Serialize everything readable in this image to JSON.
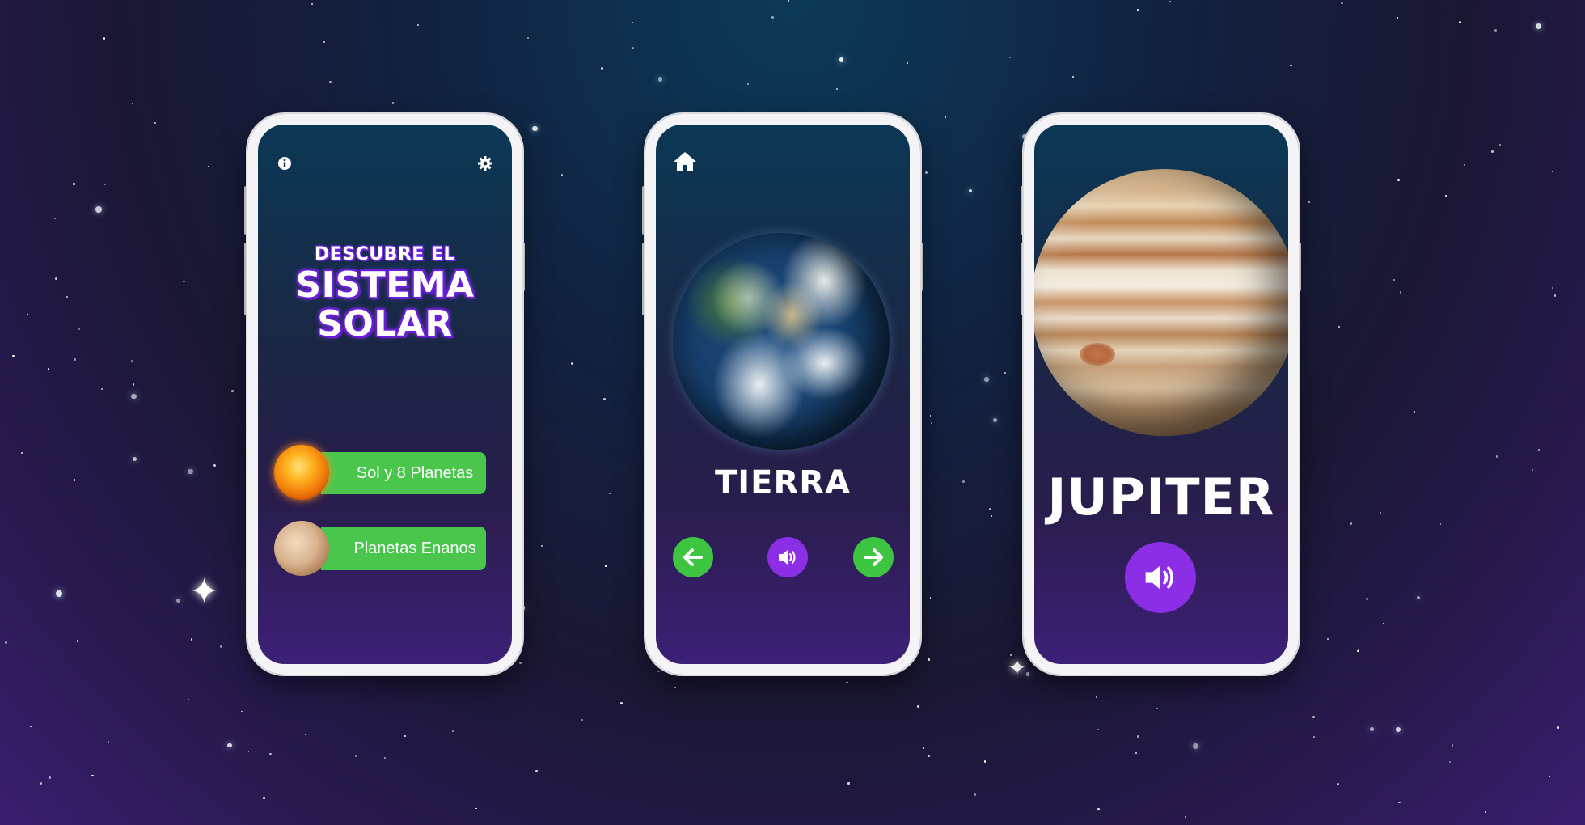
{
  "background": {
    "top_color": "#0b3a58",
    "bottom_color": "#3a1e70"
  },
  "phone1": {
    "icons": {
      "info": "info-icon",
      "settings": "gear-icon"
    },
    "title_small": "DESCUBRE EL",
    "title_line1": "SISTEMA",
    "title_line2": "SOLAR",
    "menu": [
      {
        "label": "Sol y 8 Planetas",
        "icon": "sun-icon"
      },
      {
        "label": "Planetas Enanos",
        "icon": "pluto-icon"
      }
    ],
    "button_color": "#4ac64c"
  },
  "phone2": {
    "icons": {
      "home": "home-icon",
      "prev": "arrow-left-icon",
      "sound": "speaker-icon",
      "next": "arrow-right-icon"
    },
    "planet_image": "earth",
    "planet_name": "TIERRA"
  },
  "phone3": {
    "icons": {
      "sound": "speaker-icon"
    },
    "planet_image": "jupiter",
    "planet_name": "JUPITER"
  }
}
